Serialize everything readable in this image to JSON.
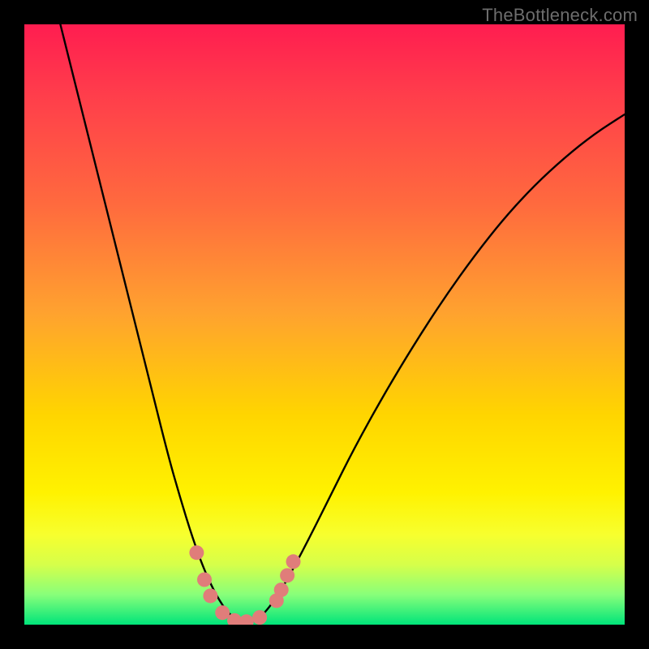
{
  "watermark": "TheBottleneck.com",
  "chart_data": {
    "type": "line",
    "title": "",
    "xlabel": "",
    "ylabel": "",
    "xlim": [
      0,
      1
    ],
    "ylim": [
      0,
      1
    ],
    "series": [
      {
        "name": "curve",
        "x": [
          0.06,
          0.09,
          0.12,
          0.15,
          0.18,
          0.21,
          0.24,
          0.26,
          0.28,
          0.3,
          0.32,
          0.34,
          0.36,
          0.38,
          0.4,
          0.43,
          0.47,
          0.51,
          0.55,
          0.6,
          0.65,
          0.7,
          0.75,
          0.8,
          0.85,
          0.9,
          0.95,
          1.0
        ],
        "y": [
          1.0,
          0.88,
          0.76,
          0.64,
          0.52,
          0.4,
          0.28,
          0.21,
          0.145,
          0.09,
          0.048,
          0.018,
          0.004,
          0.004,
          0.018,
          0.06,
          0.135,
          0.215,
          0.295,
          0.385,
          0.468,
          0.545,
          0.615,
          0.678,
          0.732,
          0.778,
          0.818,
          0.85
        ]
      }
    ],
    "markers": [
      {
        "x": 0.287,
        "y": 0.12
      },
      {
        "x": 0.3,
        "y": 0.075
      },
      {
        "x": 0.31,
        "y": 0.048
      },
      {
        "x": 0.33,
        "y": 0.02
      },
      {
        "x": 0.35,
        "y": 0.007
      },
      {
        "x": 0.37,
        "y": 0.005
      },
      {
        "x": 0.392,
        "y": 0.012
      },
      {
        "x": 0.42,
        "y": 0.04
      },
      {
        "x": 0.428,
        "y": 0.058
      },
      {
        "x": 0.438,
        "y": 0.082
      },
      {
        "x": 0.448,
        "y": 0.105
      }
    ],
    "marker_style": {
      "color": "#e07d7a",
      "radius_px": 9
    }
  }
}
